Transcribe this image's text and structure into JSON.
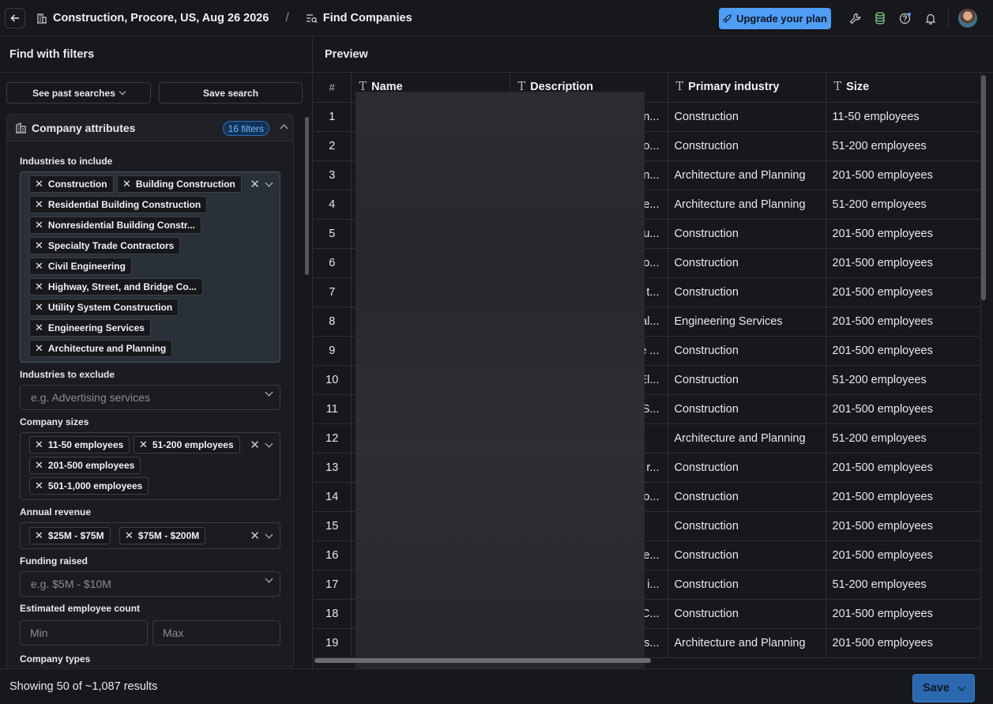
{
  "topbar": {
    "project_title": "Construction, Procore, US, Aug 26 2026",
    "separator": "/",
    "page_title": "Find Companies",
    "upgrade_label": "Upgrade your plan"
  },
  "left_panel": {
    "title": "Find with filters",
    "past_searches_label": "See past searches",
    "save_search_label": "Save search",
    "section_title": "Company attributes",
    "filters_badge": "16 filters",
    "industries_include": {
      "label": "Industries to include",
      "chips": [
        "Construction",
        "Building Construction",
        "Residential Building Construction",
        "Nonresidential Building Constr...",
        "Specialty Trade Contractors",
        "Civil Engineering",
        "Highway, Street, and Bridge Co...",
        "Utility System Construction",
        "Engineering Services",
        "Architecture and Planning"
      ]
    },
    "industries_exclude": {
      "label": "Industries to exclude",
      "placeholder": "e.g. Advertising services"
    },
    "company_sizes": {
      "label": "Company sizes",
      "chips": [
        "11-50 employees",
        "51-200 employees",
        "201-500 employees",
        "501-1,000 employees"
      ]
    },
    "annual_revenue": {
      "label": "Annual revenue",
      "chips": [
        "$25M - $75M",
        "$75M - $200M"
      ]
    },
    "funding_raised": {
      "label": "Funding raised",
      "placeholder": "e.g. $5M - $10M"
    },
    "employee_count": {
      "label": "Estimated employee count",
      "min_placeholder": "Min",
      "max_placeholder": "Max"
    },
    "company_types": {
      "label": "Company types"
    }
  },
  "preview": {
    "title": "Preview",
    "columns": [
      "#",
      "Name",
      "Description",
      "Primary industry",
      "Size"
    ],
    "rows": [
      {
        "n": "1",
        "desc_tail": "n...",
        "industry": "Construction",
        "size": "11-50 employees"
      },
      {
        "n": "2",
        "desc_tail": "o...",
        "industry": "Construction",
        "size": "51-200 employees"
      },
      {
        "n": "3",
        "desc_tail": "n...",
        "industry": "Architecture and Planning",
        "size": "201-500 employees"
      },
      {
        "n": "4",
        "desc_tail": "e...",
        "industry": "Architecture and Planning",
        "size": "51-200 employees"
      },
      {
        "n": "5",
        "desc_tail": "u...",
        "industry": "Construction",
        "size": "201-500 employees"
      },
      {
        "n": "6",
        "desc_tail": "o...",
        "industry": "Construction",
        "size": "201-500 employees"
      },
      {
        "n": "7",
        "desc_tail": "t...",
        "industry": "Construction",
        "size": "201-500 employees"
      },
      {
        "n": "8",
        "desc_tail": "al...",
        "industry": "Engineering Services",
        "size": "201-500 employees"
      },
      {
        "n": "9",
        "desc_tail": "e ...",
        "industry": "Construction",
        "size": "201-500 employees"
      },
      {
        "n": "10",
        "desc_tail": "El...",
        "industry": "Construction",
        "size": "51-200 employees"
      },
      {
        "n": "11",
        "desc_tail": "S...",
        "industry": "Construction",
        "size": "201-500 employees"
      },
      {
        "n": "12",
        "desc_tail": "",
        "industry": "Architecture and Planning",
        "size": "51-200 employees"
      },
      {
        "n": "13",
        "desc_tail": "r...",
        "industry": "Construction",
        "size": "201-500 employees"
      },
      {
        "n": "14",
        "desc_tail": "o...",
        "industry": "Construction",
        "size": "201-500 employees"
      },
      {
        "n": "15",
        "desc_tail": "",
        "industry": "Construction",
        "size": "201-500 employees"
      },
      {
        "n": "16",
        "desc_tail": "e...",
        "industry": "Construction",
        "size": "201-500 employees"
      },
      {
        "n": "17",
        "desc_tail": "i...",
        "industry": "Construction",
        "size": "51-200 employees"
      },
      {
        "n": "18",
        "desc_tail": "C...",
        "industry": "Construction",
        "size": "201-500 employees"
      },
      {
        "n": "19",
        "desc_tail": "s...",
        "industry": "Architecture and Planning",
        "size": "201-500 employees"
      }
    ]
  },
  "footer": {
    "results_text": "Showing 50 of ~1,087 results",
    "save_label": "Save"
  },
  "colors": {
    "accent": "#4f9ef5",
    "background": "#17181c",
    "badge_bg": "#10335a",
    "save_button": "#2b68b0"
  }
}
